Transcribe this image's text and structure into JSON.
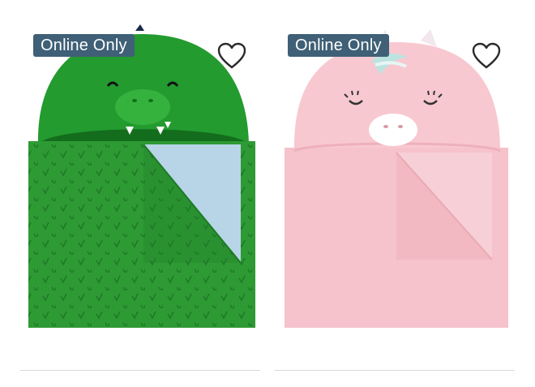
{
  "products": [
    {
      "badge": "Online Only",
      "image_icon": "dinosaur-hooded-towel",
      "colors": {
        "towel": "#2e9a34",
        "hood": "#239b2f",
        "lining": "#b7d5e6"
      },
      "favorite_icon": "heart-outline-icon"
    },
    {
      "badge": "Online Only",
      "image_icon": "unicorn-hooded-towel",
      "colors": {
        "towel": "#f6c2cb",
        "hood": "#f8c8d0",
        "lining": "#f7cfd6"
      },
      "favorite_icon": "heart-outline-icon"
    }
  ],
  "colors": {
    "badge_bg": "#3f6076",
    "badge_text": "#ffffff",
    "divider": "#d9d9d9"
  }
}
